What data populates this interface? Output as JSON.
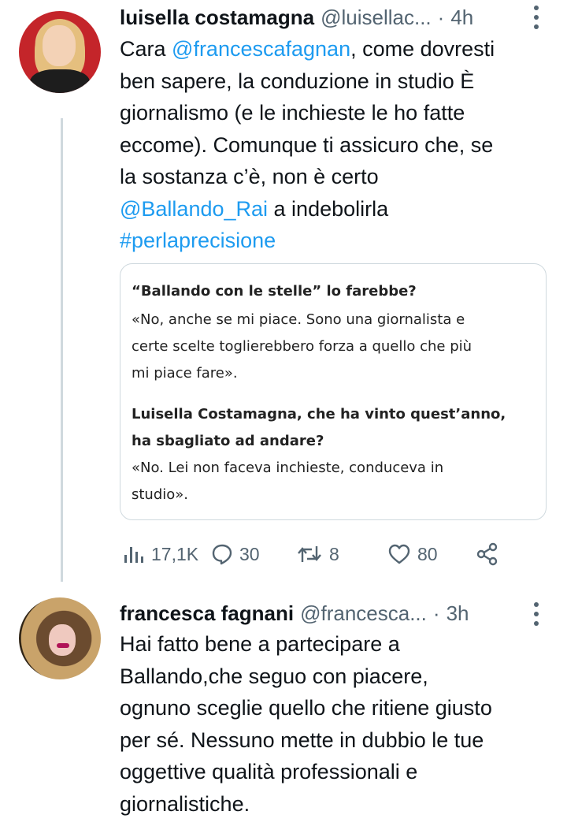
{
  "tweets": [
    {
      "name": "luisella costamagna",
      "handle": "@luisellac...",
      "time": "4h",
      "text": {
        "line1_prefix": "Cara ",
        "line1_mention": "@francescafagnan",
        "line1_suffix": ", come dovresti",
        "line2": "ben sapere, la conduzione in studio È",
        "line3": "giornalismo (e le inchieste le ho fatte",
        "line4": "eccome). Comunque ti assicuro che, se",
        "line5": "la sostanza c’è, non è certo",
        "line6_mention": "@Ballando_Rai",
        "line6_suffix": " a indebolirla",
        "line7_hashtag": "#perlaprecisione"
      },
      "quote": {
        "q1": "“Ballando con le stelle” lo farebbe?",
        "a1_line1": "«No, anche se mi piace. Sono una giornalista e",
        "a1_line2": "certe scelte toglierebbero forza a quello che più",
        "a1_line3": "mi piace fare».",
        "q2_line1": "Luisella Costamagna, che ha vinto quest’anno,",
        "q2_line2": "ha sbagliato ad andare?",
        "a2_line1": "«No. Lei non faceva inchieste, conduceva in",
        "a2_line2": "studio»."
      },
      "stats": {
        "views": "17,1K",
        "replies": "30",
        "retweets": "8",
        "likes": "80"
      }
    },
    {
      "name": "francesca fagnani",
      "handle": "@francesca...",
      "time": "3h",
      "text": {
        "line1": "Hai fatto bene a partecipare a",
        "line2": "Ballando,che seguo con piacere,",
        "line3": "ognuno sceglie quello che ritiene giusto",
        "line4": "per sé. Nessuno mette in dubbio le tue",
        "line5": "oggettive qualità professionali e",
        "line6": "giornalistiche."
      }
    }
  ],
  "colors": {
    "text": "#0f1419",
    "secondary": "#536471",
    "link": "#1d9bf0",
    "border": "#cfd9de"
  },
  "icons": [
    "views-icon",
    "reply-icon",
    "retweet-icon",
    "like-icon",
    "share-icon",
    "more-icon"
  ]
}
